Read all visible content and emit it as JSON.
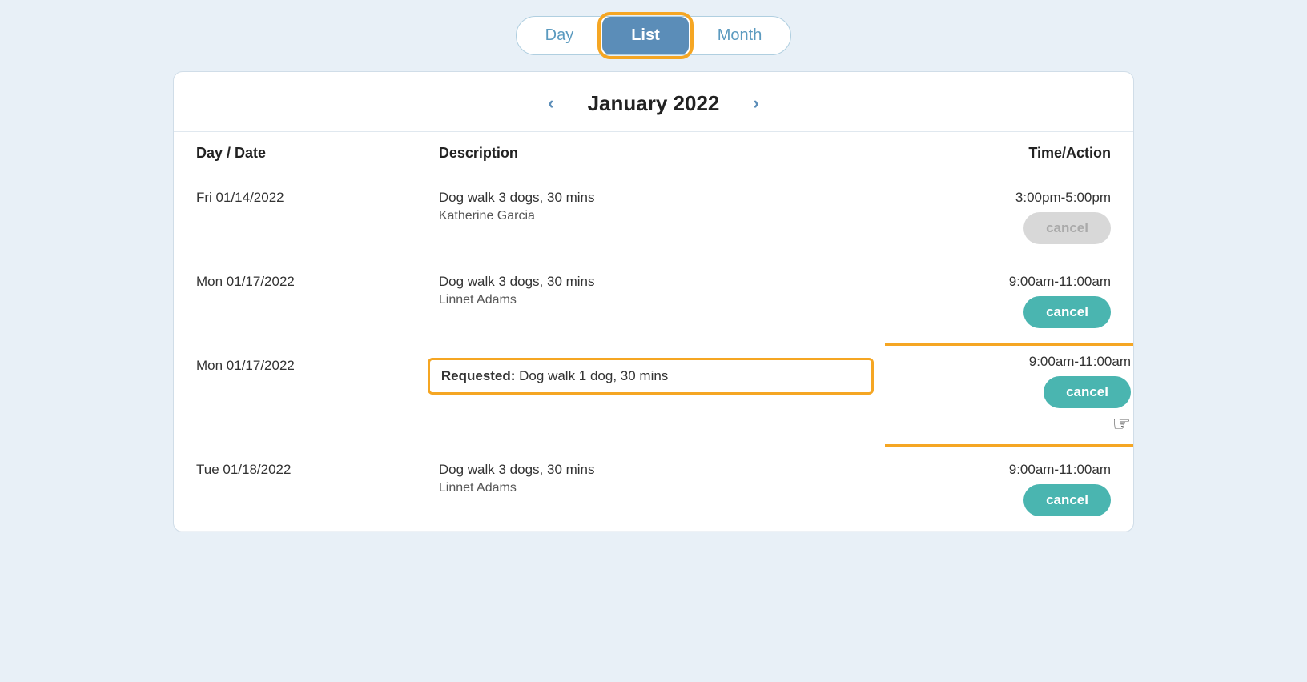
{
  "toggle": {
    "day_label": "Day",
    "list_label": "List",
    "month_label": "Month",
    "active": "list"
  },
  "nav": {
    "month_title": "January 2022",
    "prev_label": "‹",
    "next_label": "›"
  },
  "table": {
    "headers": {
      "date": "Day / Date",
      "description": "Description",
      "action": "Time/Action"
    },
    "rows": [
      {
        "date": "Fri 01/14/2022",
        "desc_line1": "Dog walk 3 dogs, 30 mins",
        "desc_line2": "Katherine Garcia",
        "time": "3:00pm-5:00pm",
        "cancel_label": "cancel",
        "cancel_disabled": true,
        "highlighted": false,
        "requested": false
      },
      {
        "date": "Mon 01/17/2022",
        "desc_line1": "Dog walk 3 dogs, 30 mins",
        "desc_line2": "Linnet Adams",
        "time": "9:00am-11:00am",
        "cancel_label": "cancel",
        "cancel_disabled": false,
        "highlighted": false,
        "requested": false
      },
      {
        "date": "Mon 01/17/2022",
        "desc_line1": "Dog walk 1 dog, 30 mins",
        "desc_line2": "",
        "time": "9:00am-11:00am",
        "cancel_label": "cancel",
        "cancel_disabled": false,
        "highlighted": true,
        "requested": true,
        "requested_label": "Requested:"
      },
      {
        "date": "Tue 01/18/2022",
        "desc_line1": "Dog walk 3 dogs, 30 mins",
        "desc_line2": "Linnet Adams",
        "time": "9:00am-11:00am",
        "cancel_label": "cancel",
        "cancel_disabled": false,
        "highlighted": false,
        "requested": false
      }
    ]
  },
  "colors": {
    "accent_orange": "#f5a623",
    "teal": "#4ab5b0",
    "blue": "#5b8db8",
    "disabled_gray": "#d8d8d8"
  }
}
